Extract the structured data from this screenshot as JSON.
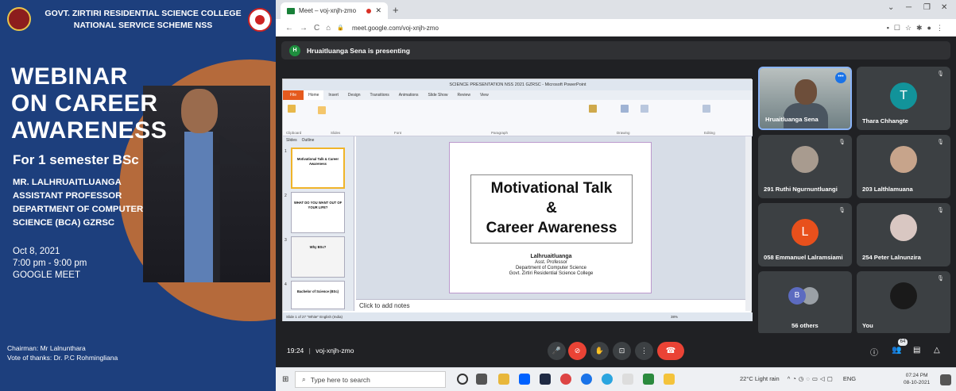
{
  "poster": {
    "college_line1": "GOVT. ZIRTIRI RESIDENTIAL SCIENCE COLLEGE",
    "college_line2": "NATIONAL SERVICE SCHEME NSS",
    "title_line1": "WEBINAR",
    "title_line2": "ON CAREER",
    "title_line3": "AWARENESS",
    "semester": "For 1 semester BSc",
    "speaker_name": "MR. LALHRUAITLUANGA",
    "speaker_role": "ASSISTANT PROFESSOR",
    "speaker_dept1": "DEPARTMENT OF COMPUTER",
    "speaker_dept2": "SCIENCE (BCA) GZRSC",
    "date": "Oct 8, 2021",
    "time": "7:00 pm - 9:00 pm",
    "platform": "GOOGLE MEET",
    "chairman": "Chairman: Mr Lalnunthara",
    "vote_of_thanks": "Vote of thanks: Dr. P.C Rohmingliana"
  },
  "browser": {
    "tab_title": "Meet – voj-xnjh-zmo",
    "url": "meet.google.com/voj-xnjh-zmo"
  },
  "presenting": {
    "avatar_letter": "H",
    "text": "Hruaitluanga Sena is presenting"
  },
  "powerpoint": {
    "window_title": "SCIENCE PRESENTATION NSS 2021 GZRSC - Microsoft PowerPoint",
    "ribbon_tabs": [
      "File",
      "Home",
      "Insert",
      "Design",
      "Transitions",
      "Animations",
      "Slide Show",
      "Review",
      "View"
    ],
    "ribbon_groups": [
      "Clipboard",
      "Slides",
      "Font",
      "Paragraph",
      "Drawing",
      "Editing"
    ],
    "panel_tabs": [
      "Slides",
      "Outline"
    ],
    "thumbnails": [
      {
        "num": "1",
        "text": "Motivational Talk & Career Awareness"
      },
      {
        "num": "2",
        "text": "WHAT DO YOU WANT OUT OF YOUR LIFE?"
      },
      {
        "num": "3",
        "text": "Why BSc?"
      },
      {
        "num": "4",
        "text": "Bachelor of Science (BSc)"
      }
    ],
    "slide_title_1": "Motivational Talk",
    "slide_title_2": "&",
    "slide_title_3": "Career Awareness",
    "presenter": "Lalhruaitluanga",
    "presenter_role": "Asst. Professor",
    "presenter_dept": "Department of Computer Science",
    "presenter_college": "Govt. Zirtiri Residential Science College",
    "notes_placeholder": "Click to add notes",
    "status": "Slide 1 of 27     \"White\"     English (India)",
    "zoom": "38%"
  },
  "participants": [
    {
      "name": "Hruaitluanga Sena"
    },
    {
      "name": "Thara Chhangte",
      "letter": "T",
      "color": "#12939a"
    },
    {
      "name": "291 Ruthi Ngurnuntluangi"
    },
    {
      "name": "203 Lalthlamuana"
    },
    {
      "name": "058 Emmanuel Lalramsiami",
      "letter": "L",
      "color": "#e8501c"
    },
    {
      "name": "254 Peter Lalnunzira"
    },
    {
      "name": "56 others",
      "letter": "B"
    },
    {
      "name": "You"
    }
  ],
  "controls": {
    "time": "19:24",
    "meeting_code": "voj-xnjh-zmo",
    "people_count": "64"
  },
  "taskbar": {
    "search_placeholder": "Type here to search",
    "weather": "22°C  Light rain",
    "lang": "ENG",
    "time": "07:24 PM",
    "date": "08-10-2021"
  }
}
